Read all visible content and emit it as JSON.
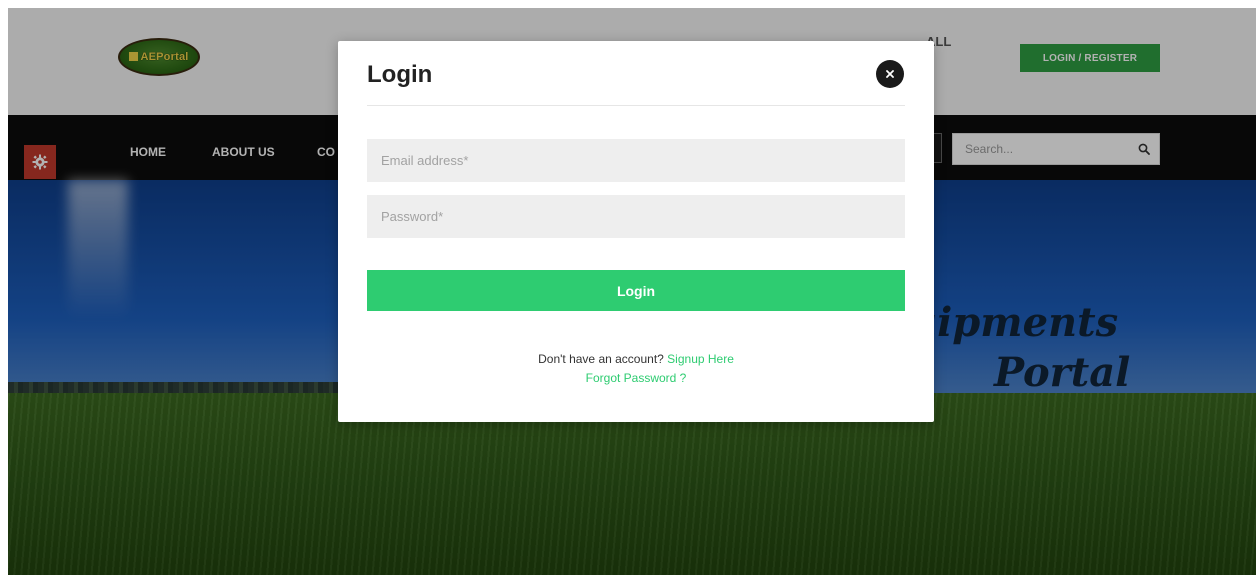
{
  "header": {
    "logo_text": "AEPortal",
    "call_text": "ALL",
    "login_register_label": "LOGIN / REGISTER"
  },
  "nav": {
    "items": [
      {
        "label": "HOME"
      },
      {
        "label": "ABOUT US"
      },
      {
        "label": "CO"
      }
    ],
    "search_placeholder": "Search..."
  },
  "hero": {
    "title_line1": "uipments",
    "title_line2": "Portal"
  },
  "modal": {
    "title": "Login",
    "email_placeholder": "Email address*",
    "password_placeholder": "Password*",
    "submit_label": "Login",
    "signup_prompt": "Don't have an account?",
    "signup_link": "Signup Here",
    "forgot_link": "Forgot Password ?"
  },
  "colors": {
    "accent_green": "#2ecc71",
    "header_button_green": "#2f9e43",
    "nav_background": "#0c0c0c",
    "gear_red": "#c0392b"
  },
  "icons": {
    "close": "close-icon",
    "search": "search-icon",
    "settings": "gear-icon"
  }
}
